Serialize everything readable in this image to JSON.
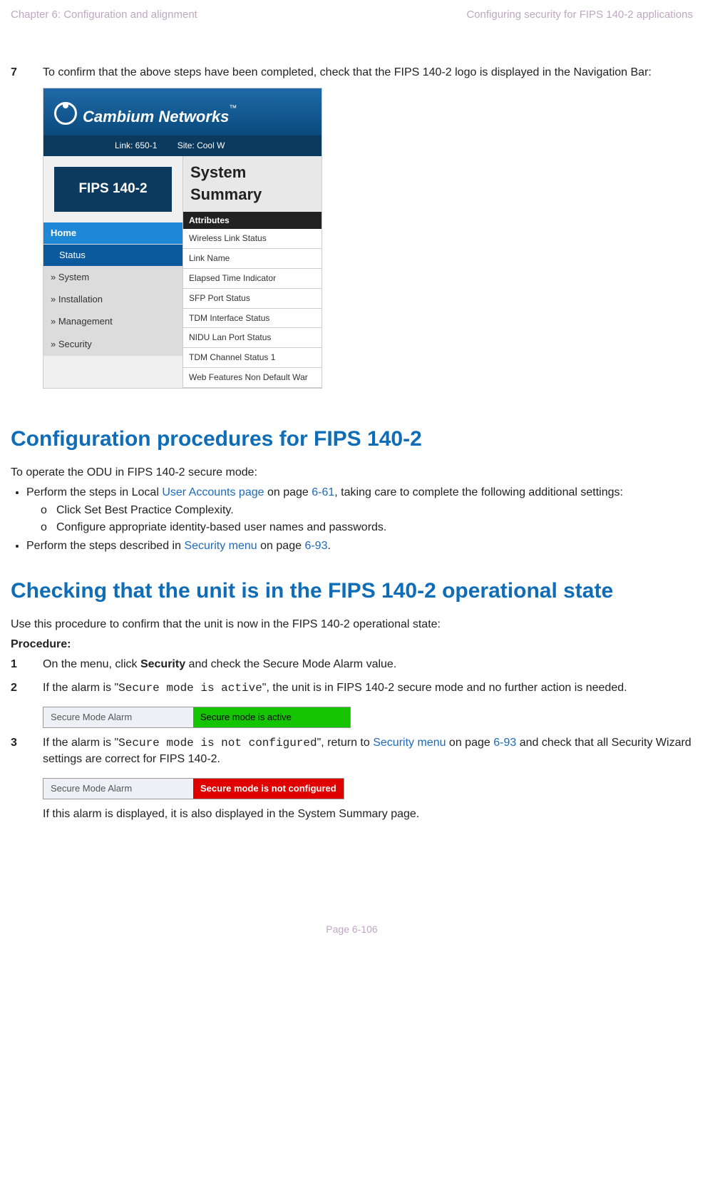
{
  "header": {
    "left": "Chapter 6:  Configuration and alignment",
    "right": "Configuring security for FIPS 140-2 applications"
  },
  "step7": {
    "num": "7",
    "text": "To confirm that the above steps have been completed, check that the FIPS 140-2 logo is displayed in the Navigation Bar:"
  },
  "ss1": {
    "brand": "Cambium Networks",
    "link_label": "Link: 650-1",
    "site_label": "Site: Cool W",
    "fips": "FIPS 140-2",
    "menu": {
      "home": "Home",
      "status": "Status",
      "system": "» System",
      "installation": "» Installation",
      "management": "» Management",
      "security": "» Security"
    },
    "right_title": "System Summary",
    "attr_hdr": "Attributes",
    "rows": [
      "Wireless Link Status",
      "Link Name",
      "Elapsed Time Indicator",
      "SFP Port Status",
      "TDM Interface Status",
      "NIDU Lan Port Status",
      "TDM Channel Status 1",
      "Web Features Non Default War"
    ]
  },
  "h2a": "Configuration procedures for FIPS 140-2",
  "intro_a": "To operate the ODU in FIPS 140-2 secure mode:",
  "bul1_pre": "Perform the steps in Local ",
  "bul1_link": "User Accounts page",
  "bul1_mid": " on page ",
  "bul1_pg": "6-61",
  "bul1_post": ", taking care to complete the following additional settings:",
  "sub1": "Click Set Best Practice Complexity.",
  "sub2": "Configure appropriate identity-based user names and passwords.",
  "bul2_pre": "Perform the steps described in ",
  "bul2_link": "Security menu",
  "bul2_mid": " on page ",
  "bul2_pg": "6-93",
  "bul2_post": ".",
  "h2b": "Checking that the unit is in the FIPS 140-2 operational state",
  "intro_b": "Use this procedure to confirm that the unit is now in the FIPS 140-2 operational state:",
  "procedure": "Procedure:",
  "p1": {
    "num": "1",
    "pre": "On the menu, click ",
    "bold": "Security",
    "post": " and check the Secure Mode Alarm value."
  },
  "p2": {
    "num": "2",
    "pre": "If the alarm is \"",
    "code": "Secure mode is active",
    "post": "\", the unit is in FIPS 140-2 secure mode and no further action is needed."
  },
  "p3": {
    "num": "3",
    "pre": "If the alarm is \"",
    "code": "Secure mode is not configured",
    "mid": "\", return to ",
    "link": "Security menu",
    "mid2": " on page ",
    "pg": "6-93",
    "post": " and check that all Security Wizard settings are correct for FIPS 140-2."
  },
  "alarm": {
    "label": "Secure Mode Alarm",
    "active": "Secure mode is active",
    "notconf": "Secure mode is not configured"
  },
  "tail": "If this alarm is displayed, it is also displayed in the System Summary page.",
  "footer": "Page 6-106"
}
